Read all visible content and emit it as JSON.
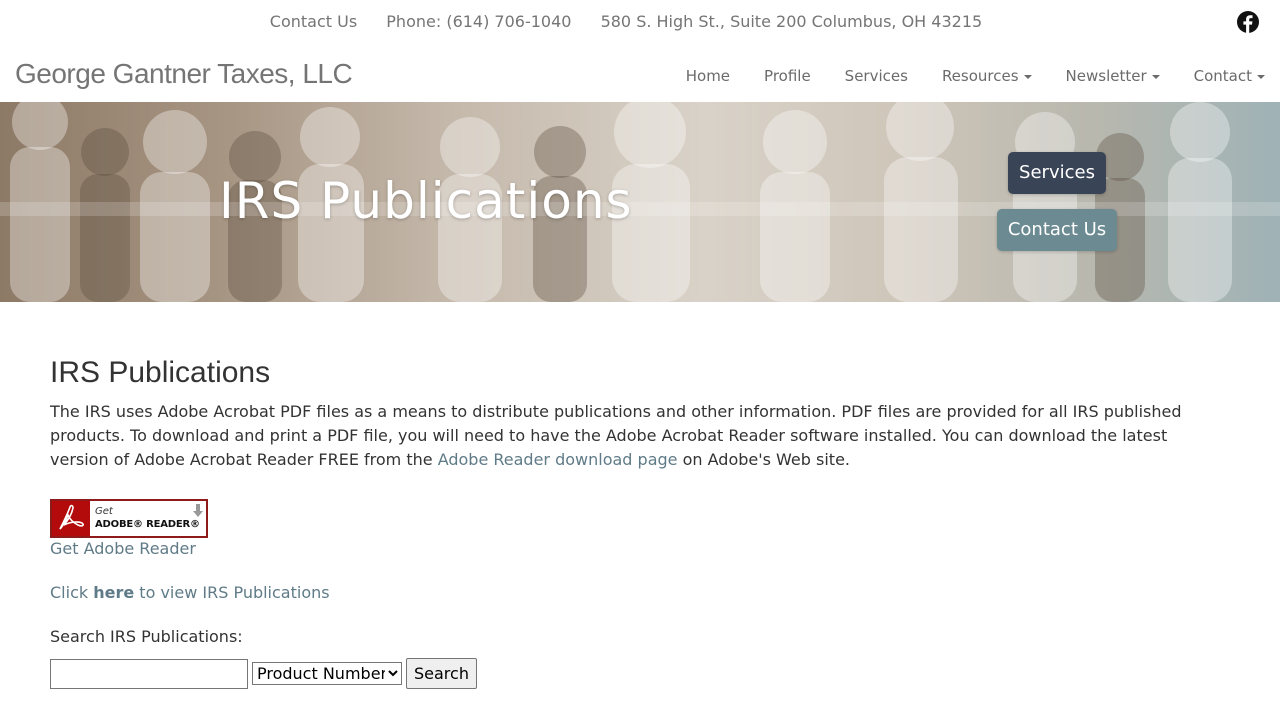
{
  "topbar": {
    "contact_us": "Contact Us",
    "phone": "Phone: (614) 706-1040",
    "address": "580 S. High St., Suite 200 Columbus, OH 43215",
    "social_icon": "facebook-icon"
  },
  "navbar": {
    "brand": "George Gantner Taxes, LLC",
    "items": [
      {
        "label": "Home",
        "dropdown": false
      },
      {
        "label": "Profile",
        "dropdown": false
      },
      {
        "label": "Services",
        "dropdown": false
      },
      {
        "label": "Resources",
        "dropdown": true
      },
      {
        "label": "Newsletter",
        "dropdown": true
      },
      {
        "label": "Contact",
        "dropdown": true
      }
    ]
  },
  "hero": {
    "title": "IRS Publications",
    "services_button": "Services",
    "contact_button": "Contact Us"
  },
  "content": {
    "heading": "IRS Publications",
    "intro_part1": "The IRS uses Adobe Acrobat PDF files as a means to distribute publications and other information. PDF files are provided for all IRS published products. To download and print a PDF file, you will need to have the Adobe Acrobat Reader software installed. You can download the latest version of Adobe Acrobat Reader FREE from the ",
    "intro_link": "Adobe Reader download page",
    "intro_part2": " on Adobe's Web site.",
    "badge_get": "Get",
    "badge_name": "ADOBE® READER®",
    "get_reader_link": "Get Adobe Reader",
    "click_prefix": "Click ",
    "click_here": "here",
    "click_suffix": " to view IRS Publications",
    "search_label": "Search IRS Publications:",
    "search_value": "",
    "search_select": "Product Number",
    "search_button": "Search"
  },
  "colors": {
    "brand_gray": "#757575",
    "link": "#5f7b87",
    "services_button": "#3a4457",
    "contact_button": "#6b8a92",
    "adobe_red": "#b30b0b"
  }
}
